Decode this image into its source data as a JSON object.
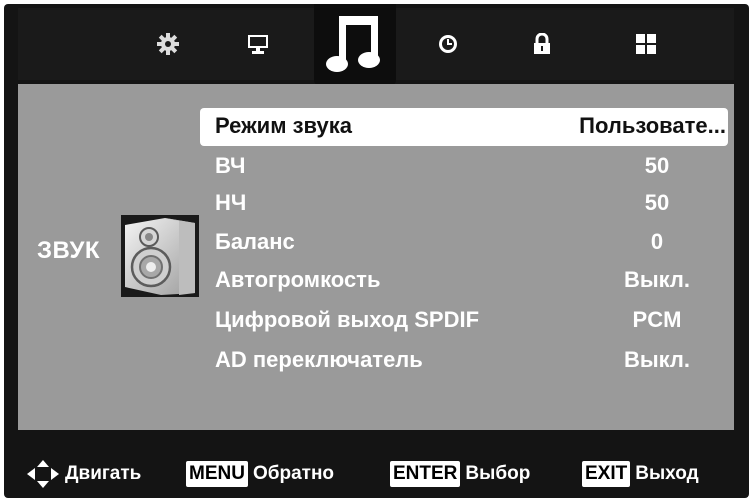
{
  "tabs": [
    {
      "name": "settings",
      "icon": "gear-icon"
    },
    {
      "name": "picture",
      "icon": "monitor-icon"
    },
    {
      "name": "sound",
      "icon": "music-note-icon",
      "active": true
    },
    {
      "name": "time",
      "icon": "clock-icon"
    },
    {
      "name": "lock",
      "icon": "padlock-icon"
    },
    {
      "name": "apps",
      "icon": "grid-icon"
    }
  ],
  "section": {
    "title": "ЗВУК",
    "icon": "speaker-icon"
  },
  "menu": [
    {
      "label": "Режим звука",
      "value": "Пользовате...",
      "selected": true
    },
    {
      "label": "ВЧ",
      "value": "50"
    },
    {
      "label": "НЧ",
      "value": "50"
    },
    {
      "label": "Баланс",
      "value": "0"
    },
    {
      "label": "Автогромкость",
      "value": "Выкл."
    },
    {
      "label": "Цифровой выход SPDIF",
      "value": "PCM"
    },
    {
      "label": "AD переключатель",
      "value": "Выкл."
    }
  ],
  "footer": {
    "move": {
      "icon": "dpad-icon",
      "label": "Двигать"
    },
    "menu": {
      "key": "MENU",
      "label": "Обратно"
    },
    "enter": {
      "key": "ENTER",
      "label": "Выбор"
    },
    "exit": {
      "key": "EXIT",
      "label": "Выход"
    }
  },
  "colors": {
    "background": "#141414",
    "panel": "#9a9a9a",
    "selected_row": "#ffffff",
    "text": "#ffffff"
  }
}
